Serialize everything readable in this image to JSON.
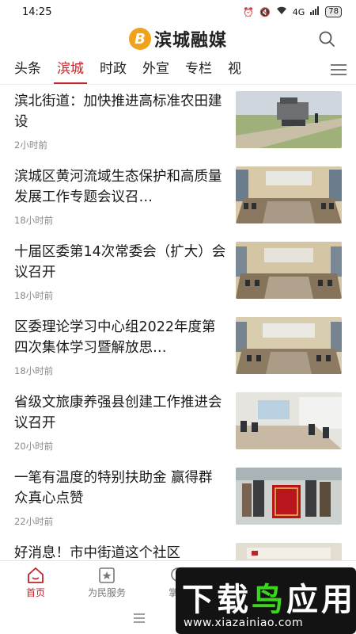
{
  "status": {
    "time": "14:25",
    "battery": "78",
    "signal": "4G"
  },
  "header": {
    "logo_mark": "B",
    "app_name": "滨城融媒"
  },
  "tabs": [
    {
      "label": "头条"
    },
    {
      "label": "滨城"
    },
    {
      "label": "时政"
    },
    {
      "label": "外宣"
    },
    {
      "label": "专栏"
    },
    {
      "label": "视"
    }
  ],
  "active_tab": "滨城",
  "news": [
    {
      "title": "滨北街道：加快推进高标准农田建设",
      "time": "2小时前"
    },
    {
      "title": "滨城区黄河流域生态保护和高质量发展工作专题会议召…",
      "time": "18小时前"
    },
    {
      "title": "十届区委第14次常委会（扩大）会议召开",
      "time": "18小时前"
    },
    {
      "title": "区委理论学习中心组2022年度第四次集体学习暨解放思…",
      "time": "18小时前"
    },
    {
      "title": "省级文旅康养强县创建工作推进会议召开",
      "time": "20小时前"
    },
    {
      "title": "一笔有温度的特别扶助金 赢得群众真心点赞",
      "time": "22小时前"
    },
    {
      "title": "好消息！市中街道这个社区",
      "time": ""
    }
  ],
  "bottom_nav": [
    {
      "label": "首页"
    },
    {
      "label": "为民服务"
    },
    {
      "label": "掌上"
    }
  ],
  "watermark": {
    "text_white": "下载",
    "text_green": "鸟",
    "text_white2": "应用",
    "url": "www.xiazainiao.com"
  },
  "colors": {
    "accent": "#c32128",
    "logo": "#f0a21d",
    "watermark_green": "#39d81d"
  }
}
